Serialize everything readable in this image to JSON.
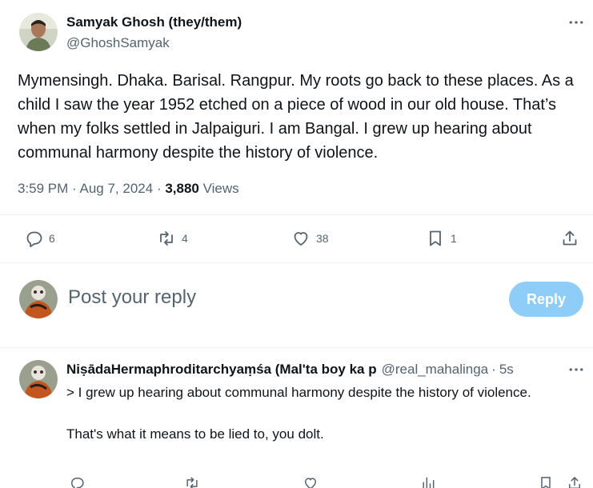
{
  "tweet": {
    "author_name": "Samyak Ghosh (they/them)",
    "author_handle": "@GhoshSamyak",
    "text": "Mymensingh. Dhaka. Barisal. Rangpur. My roots go back to these places. As a child I saw the year 1952 etched on a piece of wood in our old house. That’s when my folks settled in Jalpaiguri. I am Bangal. I grew up hearing about communal harmony despite the history of violence.",
    "time": "3:59 PM",
    "date": "Aug 7, 2024",
    "views_count": "3,880",
    "views_label": "Views",
    "replies": "6",
    "reposts": "4",
    "likes": "38",
    "bookmarks": "1"
  },
  "composer": {
    "placeholder": "Post your reply",
    "button_label": "Reply"
  },
  "reply": {
    "author_name": "NiṣādaHermaphroditarchyaṃśa (Mal'ta boy ka p",
    "author_handle": "@real_mahalinga",
    "time": "5s",
    "text": "> I grew up hearing about communal harmony despite the history of violence.\n\nThat's what it means to be lied to, you dolt."
  },
  "colors": {
    "text_primary": "#0f1419",
    "text_secondary": "#536471",
    "reply_button": "#8ecdf8",
    "divider": "#eff3f4"
  },
  "icons": {
    "more": "more-horizontal-icon",
    "reply": "reply-icon",
    "repost": "repost-icon",
    "like": "heart-icon",
    "bookmark": "bookmark-icon",
    "share": "share-icon",
    "analytics": "analytics-icon"
  }
}
